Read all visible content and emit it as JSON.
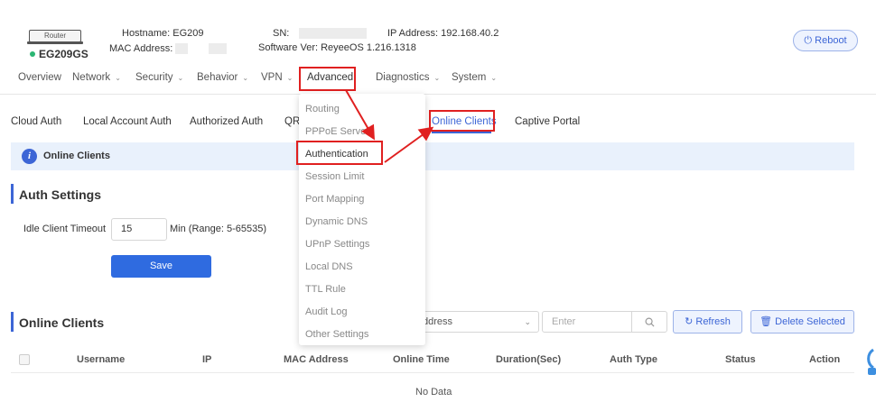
{
  "device": {
    "router_label": "Router",
    "model": "EG209GS",
    "hostname_label": "Hostname:",
    "hostname": "EG209",
    "mac_label": "MAC Address:",
    "sn_label": "SN:",
    "software_label": "Software Ver:",
    "software": "ReyeeOS 1.216.1318",
    "ip_label": "IP Address:",
    "ip": "192.168.40.2",
    "status_color": "#2bb673"
  },
  "header": {
    "reboot_label": "Reboot",
    "reboot_icon": "power-icon"
  },
  "nav": {
    "items": [
      {
        "label": "Overview",
        "has_caret": false
      },
      {
        "label": "Network",
        "has_caret": true
      },
      {
        "label": "Security",
        "has_caret": true
      },
      {
        "label": "Behavior",
        "has_caret": true
      },
      {
        "label": "VPN",
        "has_caret": true
      },
      {
        "label": "Advanced",
        "has_caret": true,
        "active": true
      },
      {
        "label": "Diagnostics",
        "has_caret": true
      },
      {
        "label": "System",
        "has_caret": true
      }
    ]
  },
  "dropdown": {
    "items": [
      "Routing",
      "PPPoE Server",
      "Authentication",
      "Session Limit",
      "Port Mapping",
      "Dynamic DNS",
      "UPnP Settings",
      "Local DNS",
      "TTL Rule",
      "Audit Log",
      "Other Settings"
    ],
    "selected": "Authentication"
  },
  "subtabs": {
    "items": [
      "Cloud Auth",
      "Local Account Auth",
      "Authorized Auth",
      "QR",
      "Online Clients",
      "Captive Portal"
    ],
    "active": "Online Clients"
  },
  "info_bar": {
    "title": "Online Clients",
    "icon": "info-icon"
  },
  "auth_settings": {
    "title": "Auth Settings",
    "idle_label": "Idle Client Timeout",
    "idle_value": "15",
    "idle_hint": "Min (Range: 5-65535)",
    "save_label": "Save"
  },
  "online_clients": {
    "title": "Online Clients",
    "filter_select": "ddress",
    "search_placeholder": "Enter",
    "refresh_label": "Refresh",
    "delete_label": "Delete Selected",
    "columns": [
      "Username",
      "IP",
      "MAC Address",
      "Online Time",
      "Duration(Sec)",
      "Auth Type",
      "Status",
      "Action"
    ],
    "empty_text": "No Data"
  },
  "colors": {
    "accent": "#3d66d6",
    "annotation": "#e02020",
    "primary_button": "#2f6be0"
  }
}
